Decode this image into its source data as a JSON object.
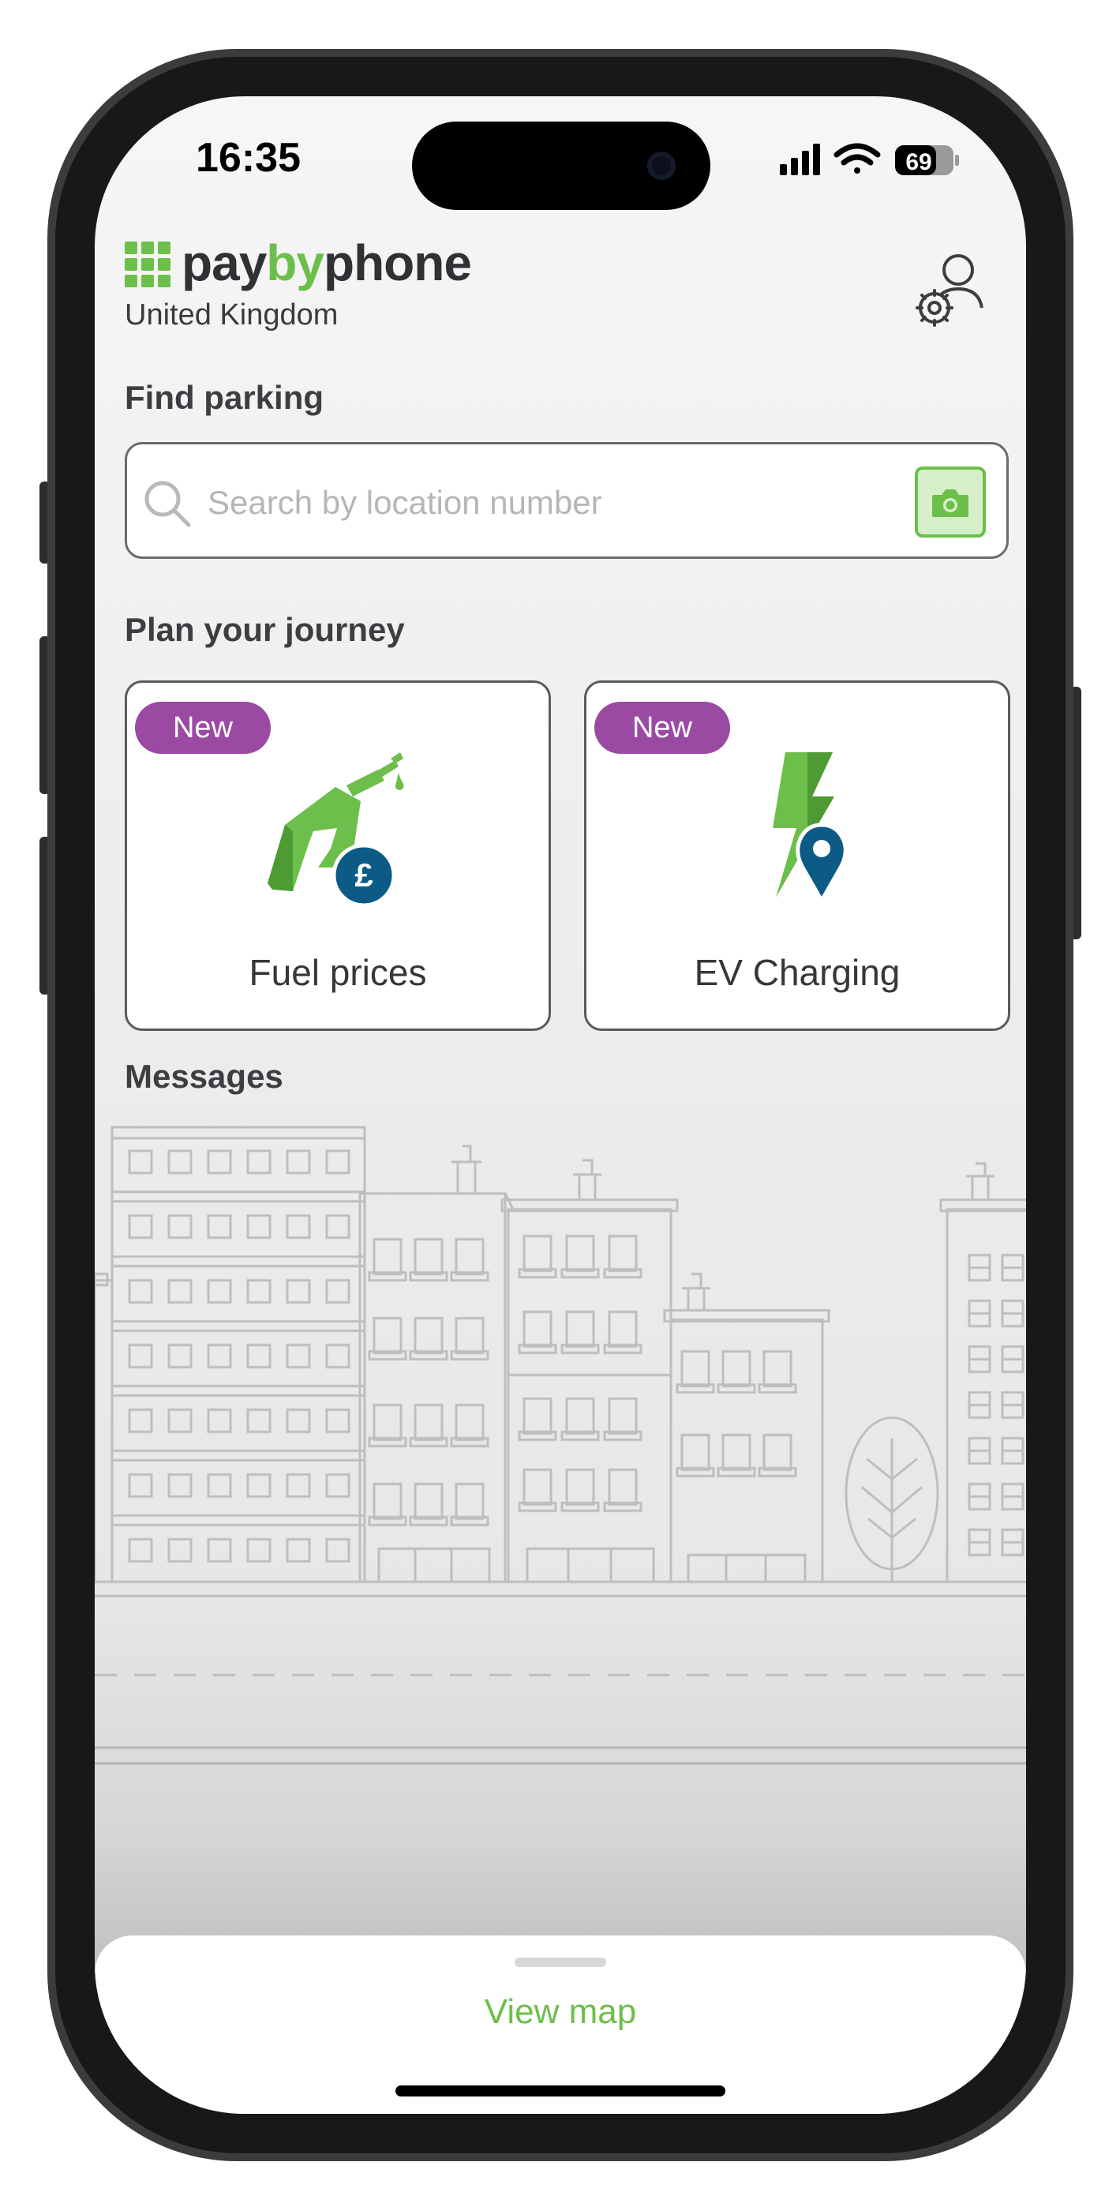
{
  "status_bar": {
    "time": "16:35",
    "battery": "69"
  },
  "header": {
    "brand_pay": "pay",
    "brand_by": "by",
    "brand_phone": "phone",
    "region": "United Kingdom"
  },
  "find_parking": {
    "title": "Find parking",
    "search_placeholder": "Search by location number"
  },
  "journey": {
    "title": "Plan your journey",
    "cards": [
      {
        "badge": "New",
        "label": "Fuel prices"
      },
      {
        "badge": "New",
        "label": "EV Charging"
      }
    ]
  },
  "messages": {
    "title": "Messages"
  },
  "sheet": {
    "view_map": "View map"
  },
  "colors": {
    "brand_green": "#6cbf4a",
    "badge_purple": "#9b4aa4",
    "pin_blue": "#0b5b86"
  }
}
